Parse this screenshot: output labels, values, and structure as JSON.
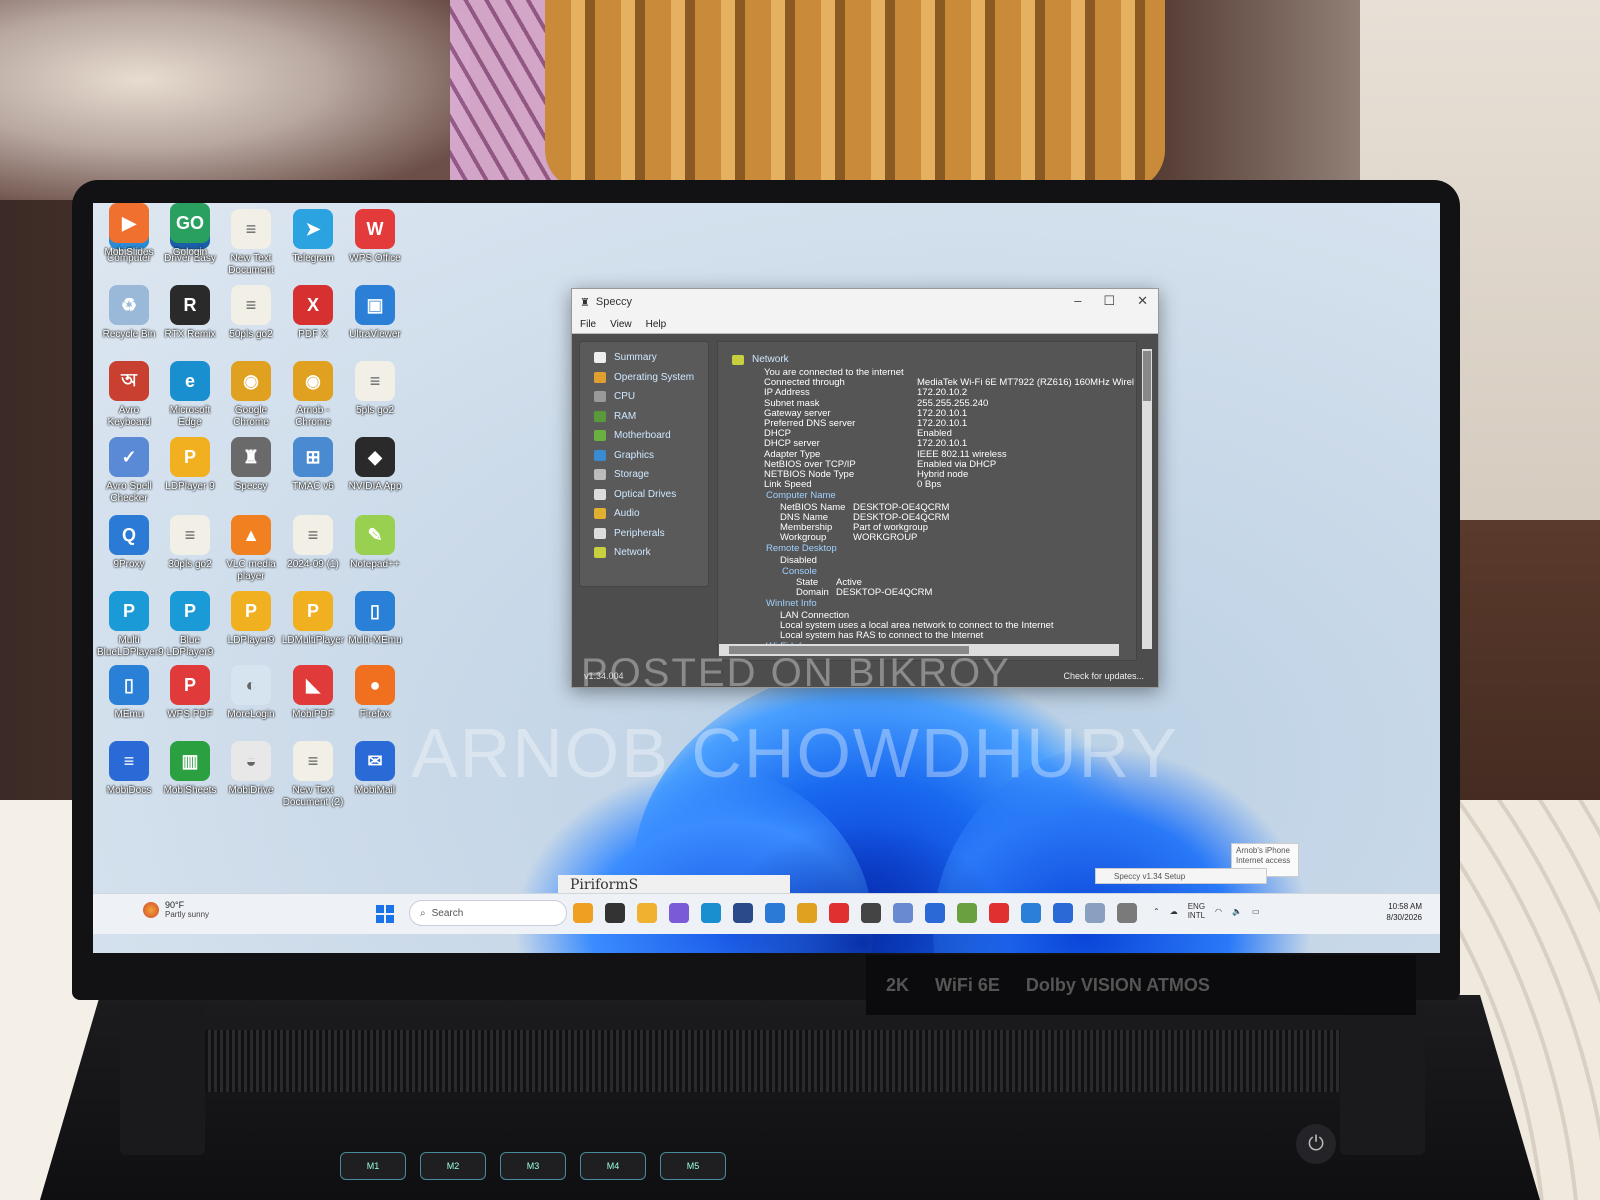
{
  "desktop": {
    "icons": [
      {
        "label": "Computer",
        "color": "#2b8bd6",
        "glyph": "▭"
      },
      {
        "label": "Driver Easy",
        "color": "#1b5ea8",
        "glyph": "◈"
      },
      {
        "label": "New Text Document",
        "color": "#f1efe6",
        "glyph": "≡"
      },
      {
        "label": "Telegram",
        "color": "#2aa3e0",
        "glyph": "➤"
      },
      {
        "label": "WPS Office",
        "color": "#e33b3b",
        "glyph": "W"
      },
      {
        "label": "Recycle Bin",
        "color": "#9ab8d8",
        "glyph": "♻"
      },
      {
        "label": "RTX Remix",
        "color": "#2a2a2a",
        "glyph": "R"
      },
      {
        "label": "50pls go2",
        "color": "#f1efe6",
        "glyph": "≡"
      },
      {
        "label": "PDF X",
        "color": "#d63030",
        "glyph": "X"
      },
      {
        "label": "UltraViewer",
        "color": "#2b7fd6",
        "glyph": "▣"
      },
      {
        "label": "Avro Keyboard",
        "color": "#c94030",
        "glyph": "অ"
      },
      {
        "label": "Microsoft Edge",
        "color": "#1a8fd0",
        "glyph": "e"
      },
      {
        "label": "Google Chrome",
        "color": "#e0a020",
        "glyph": "◉"
      },
      {
        "label": "Arnob - Chrome",
        "color": "#e0a020",
        "glyph": "◉"
      },
      {
        "label": "5pls go2",
        "color": "#f1efe6",
        "glyph": "≡"
      },
      {
        "label": "Avro Spell Checker",
        "color": "#5a8ad6",
        "glyph": "✓"
      },
      {
        "label": "LDPlayer 9",
        "color": "#f0b020",
        "glyph": "P"
      },
      {
        "label": "Speccy",
        "color": "#6a6a6a",
        "glyph": "♜"
      },
      {
        "label": "TMAC v6",
        "color": "#4a8ad0",
        "glyph": "⊞"
      },
      {
        "label": "NVIDIA App",
        "color": "#2a2a2a",
        "glyph": "◆"
      },
      {
        "label": "9Proxy",
        "color": "#2a7ad6",
        "glyph": "Q"
      },
      {
        "label": "30pls go2",
        "color": "#f1efe6",
        "glyph": "≡"
      },
      {
        "label": "VLC media player",
        "color": "#f08020",
        "glyph": "▲"
      },
      {
        "label": "2024-09 (1)",
        "color": "#f1efe6",
        "glyph": "≡"
      },
      {
        "label": "Notepad++",
        "color": "#9ad050",
        "glyph": "✎"
      },
      {
        "label": "Multi BlueLDPlayer9",
        "color": "#1a9ad6",
        "glyph": "P"
      },
      {
        "label": "Blue LDPlayer9",
        "color": "#1a9ad6",
        "glyph": "P"
      },
      {
        "label": "LDPlayer9",
        "color": "#f0b020",
        "glyph": "P"
      },
      {
        "label": "LDMultiPlayer",
        "color": "#f0b020",
        "glyph": "P"
      },
      {
        "label": "Multi-MEmu",
        "color": "#2a80d6",
        "glyph": "▯"
      },
      {
        "label": "MEmu",
        "color": "#2a80d6",
        "glyph": "▯"
      },
      {
        "label": "WPS PDF",
        "color": "#e03a3a",
        "glyph": "P"
      },
      {
        "label": "MoreLogin",
        "color": "#d6e4f0",
        "glyph": "◐"
      },
      {
        "label": "MobiPDF",
        "color": "#e03a3a",
        "glyph": "◣"
      },
      {
        "label": "Firefox",
        "color": "#f07020",
        "glyph": "●"
      },
      {
        "label": "MobiDocs",
        "color": "#2a6ad6",
        "glyph": "≡"
      },
      {
        "label": "MobiSheets",
        "color": "#2aa040",
        "glyph": "▥"
      },
      {
        "label": "MobiDrive",
        "color": "#e8e8e8",
        "glyph": "◒"
      },
      {
        "label": "New Text Document (2)",
        "color": "#f1efe6",
        "glyph": "≡"
      },
      {
        "label": "MobiMail",
        "color": "#2a6ad6",
        "glyph": "✉"
      },
      {
        "label": "MobiSlides",
        "color": "#f07030",
        "glyph": "▶"
      },
      {
        "label": "Gologin",
        "color": "#2aa060",
        "glyph": "GO"
      }
    ]
  },
  "speccy": {
    "title": "Speccy",
    "menu": [
      "File",
      "View",
      "Help"
    ],
    "sidebar": [
      "Summary",
      "Operating System",
      "CPU",
      "RAM",
      "Motherboard",
      "Graphics",
      "Storage",
      "Optical Drives",
      "Audio",
      "Peripherals",
      "Network"
    ],
    "section": "Network",
    "status": "You are connected to the internet",
    "rows": [
      {
        "k": "Connected through",
        "v": "MediaTek Wi-Fi 6E MT7922 (RZ616) 160MHz Wirel"
      },
      {
        "k": "IP Address",
        "v": "172.20.10.2"
      },
      {
        "k": "Subnet mask",
        "v": "255.255.255.240"
      },
      {
        "k": "Gateway server",
        "v": "172.20.10.1"
      },
      {
        "k": "Preferred DNS server",
        "v": "172.20.10.1"
      },
      {
        "k": "DHCP",
        "v": "Enabled"
      },
      {
        "k": "DHCP server",
        "v": "172.20.10.1"
      },
      {
        "k": "Adapter Type",
        "v": "IEEE 802.11 wireless"
      },
      {
        "k": "NetBIOS over TCP/IP",
        "v": "Enabled via DHCP"
      },
      {
        "k": "NETBIOS Node Type",
        "v": "Hybrid node"
      },
      {
        "k": "Link Speed",
        "v": "0 Bps"
      }
    ],
    "computer_name": {
      "head": "Computer Name",
      "rows": [
        {
          "k": "NetBIOS Name",
          "v": "DESKTOP-OE4QCRM"
        },
        {
          "k": "DNS Name",
          "v": "DESKTOP-OE4QCRM"
        },
        {
          "k": "Membership",
          "v": "Part of workgroup"
        },
        {
          "k": "Workgroup",
          "v": "WORKGROUP"
        }
      ]
    },
    "remote_desktop": {
      "head": "Remote Desktop",
      "status": "Disabled",
      "console_head": "Console",
      "rows": [
        {
          "k": "State",
          "v": "Active"
        },
        {
          "k": "Domain",
          "v": "DESKTOP-OE4QCRM"
        }
      ]
    },
    "wininet": {
      "head": "WinInet Info",
      "lines": [
        "LAN Connection",
        "Local system uses a local area network to connect to the Internet",
        "Local system has RAS to connect to the Internet"
      ]
    },
    "wifi_head": "Wi-Fi Info",
    "version": "v1.34.004",
    "check_updates": "Check for updates..."
  },
  "watermark": {
    "line1": "POSTED ON BIKROY",
    "line2": "ARNOB CHOWDHURY"
  },
  "notification": {
    "text": "Arnob's iPhone Internet access"
  },
  "mini_tab": {
    "text": "Speccy v1.34 Setup"
  },
  "partial_window": {
    "text": "PiriformS"
  },
  "taskbar": {
    "weather_temp": "90°F",
    "weather_desc": "Partly sunny",
    "search_placeholder": "Search",
    "apps": [
      "#f0a020",
      "#333",
      "#f0b030",
      "#7a5ad6",
      "#1a8fd0",
      "#2a4a8a",
      "#2a7ad6",
      "#e0a020",
      "#e03030",
      "#444",
      "#6a8ad0",
      "#2a6ad6",
      "#6aa040",
      "#e03030",
      "#2a80d6",
      "#2a6ad6",
      "#8aa0c0",
      "#7a7a7a"
    ],
    "lang1": "ENG",
    "lang2": "INTL",
    "time": "10:58 AM",
    "date": "8/30/2026"
  },
  "hardware": {
    "fkeys": [
      "M1",
      "M2",
      "M3",
      "M4",
      "M5"
    ],
    "stickers": [
      "2K",
      "WiFi 6E",
      "Dolby VISION ATMOS"
    ]
  }
}
